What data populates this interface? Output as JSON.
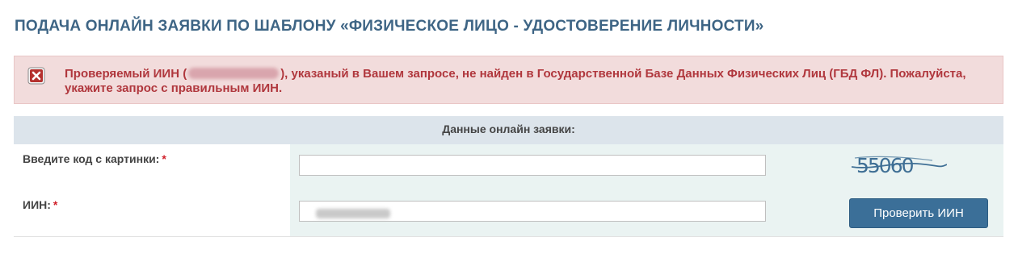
{
  "page": {
    "title": "ПОДАЧА ОНЛАЙН ЗАЯВКИ ПО ШАБЛОНУ «ФИЗИЧЕСКОЕ ЛИЦО - УДОСТОВЕРЕНИЕ ЛИЧНОСТИ»"
  },
  "alert": {
    "icon": "error-close-icon",
    "text_before": "Проверяемый ИИН (",
    "text_after": "), указаный в Вашем запросе, не найден в Государственной Базе Данных Физических Лиц (ГБД ФЛ). Пожалуйста, укажите запрос с правильным ИИН.",
    "color": "#b0373d",
    "background": "#f2dcdc"
  },
  "form": {
    "header": "Данные онлайн заявки:",
    "captcha_label": "Введите код с картинки:",
    "captcha_value": "",
    "captcha_image_text": "55060",
    "iin_label": "ИИН:",
    "required_mark": "*",
    "check_button": "Проверить ИИН",
    "accent_color": "#3b6f98"
  }
}
